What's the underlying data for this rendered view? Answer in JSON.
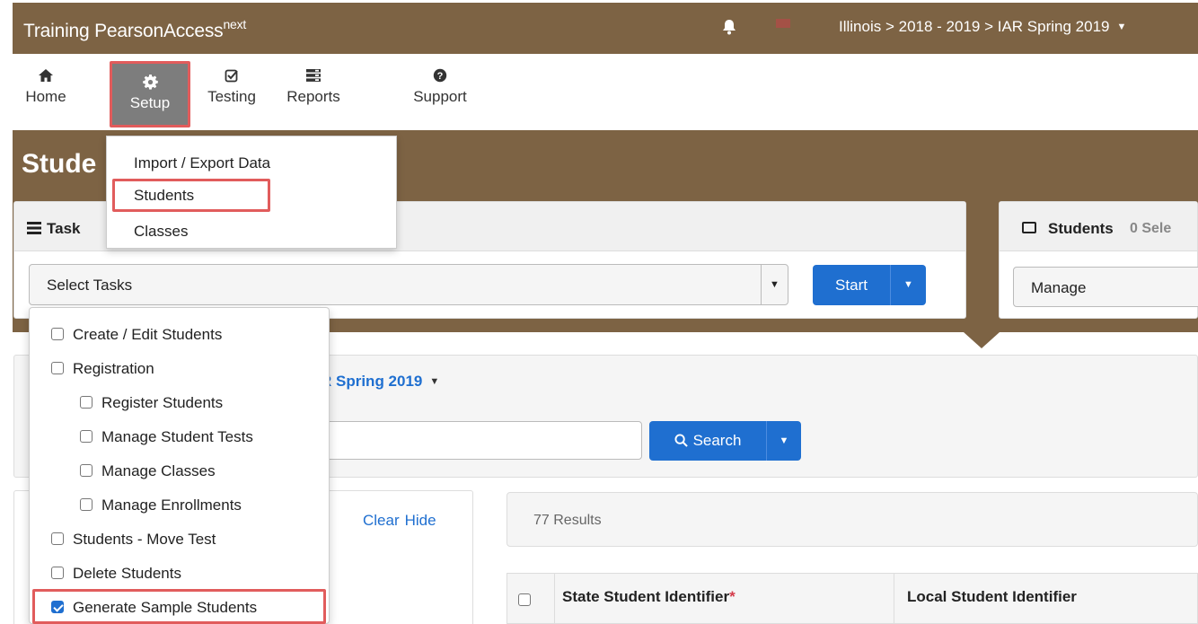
{
  "app": {
    "brand": "Training PearsonAccess",
    "brand_sup": "next",
    "breadcrumb": "Illinois > 2018 - 2019 > IAR Spring 2019",
    "colors": {
      "brand_bar": "#7d6344",
      "primary": "#1f6fd0",
      "highlight": "#e15c5c"
    }
  },
  "nav": {
    "items": [
      {
        "label": "Home",
        "icon": "home-icon"
      },
      {
        "label": "Setup",
        "icon": "gear-icon"
      },
      {
        "label": "Testing",
        "icon": "checkbox-icon"
      },
      {
        "label": "Reports",
        "icon": "list-icon"
      },
      {
        "label": "Support",
        "icon": "question-icon"
      }
    ]
  },
  "setup_menu": {
    "items": [
      "Import / Export Data",
      "Students",
      "Classes"
    ]
  },
  "page": {
    "title": "Stude"
  },
  "tasks_panel": {
    "header": "Task",
    "select_placeholder": "Select Tasks",
    "start_label": "Start"
  },
  "students_panel": {
    "header": "Students",
    "selected": "0 Sele",
    "action": "Manage"
  },
  "task_options": [
    {
      "label": "Create / Edit Students",
      "checked": false,
      "indent": 0
    },
    {
      "label": "Registration",
      "checked": false,
      "indent": 0
    },
    {
      "label": "Register Students",
      "checked": false,
      "indent": 1
    },
    {
      "label": "Manage Student Tests",
      "checked": false,
      "indent": 1
    },
    {
      "label": "Manage Classes",
      "checked": false,
      "indent": 1
    },
    {
      "label": "Manage Enrollments",
      "checked": false,
      "indent": 1
    },
    {
      "label": "Students - Move Test",
      "checked": false,
      "indent": 0
    },
    {
      "label": "Delete Students",
      "checked": false,
      "indent": 0
    },
    {
      "label": "Generate Sample Students",
      "checked": true,
      "indent": 0
    }
  ],
  "filter": {
    "test_name": "R Spring 2019",
    "search_label": "Search",
    "clear_label": "Clear",
    "hide_label": "Hide"
  },
  "results": {
    "count_text": "77 Results",
    "columns": [
      "State Student Identifier",
      "Local Student Identifier"
    ],
    "required_mark": "*"
  }
}
